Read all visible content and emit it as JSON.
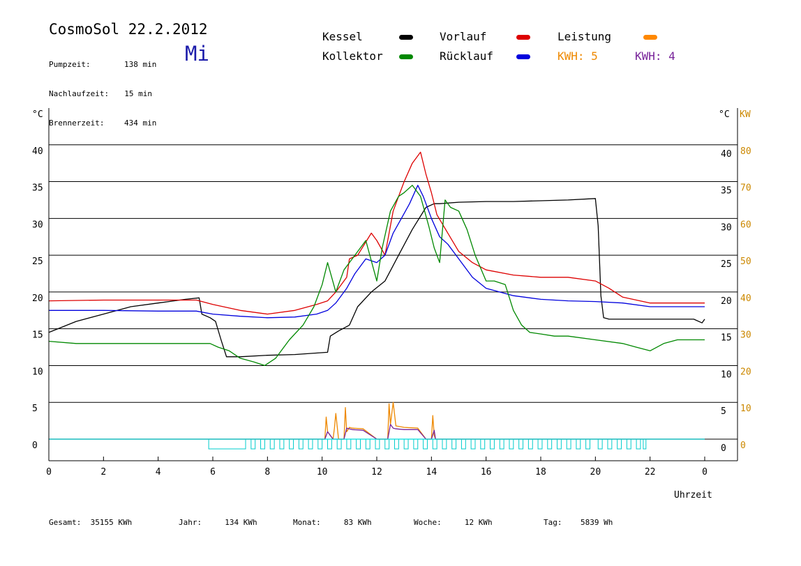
{
  "header": {
    "title": "CosmoSol 22.2.2012",
    "weekday": "Mi",
    "stats": [
      {
        "label": "Pumpzeit:",
        "value": "138 min"
      },
      {
        "label": "Nachlaufzeit:",
        "value": "15 min"
      },
      {
        "label": "Brennerzeit:",
        "value": "434 min"
      }
    ]
  },
  "legend": {
    "kessel": {
      "label": "Kessel",
      "color": "#000000"
    },
    "vorlauf": {
      "label": "Vorlauf",
      "color": "#dd0000"
    },
    "leistung": {
      "label": "Leistung",
      "color": "#ff8800"
    },
    "kollektor": {
      "label": "Kollektor",
      "color": "#008800"
    },
    "ruecklauf": {
      "label": "Rücklauf",
      "color": "#0000dd"
    },
    "kwh_orange": "KWH: 5",
    "kwh_purple": "KWH: 4",
    "kwh_orange_color": "#ee8800",
    "kwh_purple_color": "#772299"
  },
  "footer": {
    "gesamt": {
      "label": "Gesamt:",
      "value": "35155 KWh"
    },
    "jahr": {
      "label": "Jahr:",
      "value": "134 KWh"
    },
    "monat": {
      "label": "Monat:",
      "value": "83 KWh"
    },
    "woche": {
      "label": "Woche:",
      "value": "12 KWh"
    },
    "tag": {
      "label": "Tag:",
      "value": "5839 Wh"
    }
  },
  "chart_data": {
    "type": "line",
    "xlabel": "Uhrzeit",
    "ylabel_left": "°C",
    "ylabel_right": "°C",
    "ylabel_power": "KW",
    "xlim": [
      0,
      24
    ],
    "ylim": [
      0,
      45
    ],
    "x_ticks": [
      "0",
      "2",
      "4",
      "6",
      "8",
      "10",
      "12",
      "14",
      "16",
      "18",
      "20",
      "22",
      "0"
    ],
    "y_ticks_left": [
      "0",
      "5",
      "10",
      "15",
      "20",
      "25",
      "30",
      "35",
      "40"
    ],
    "y_ticks_right": [
      "0",
      "5",
      "10",
      "15",
      "20",
      "25",
      "30",
      "35",
      "40"
    ],
    "y_ticks_power": [
      "0",
      "10",
      "20",
      "30",
      "40",
      "50",
      "60",
      "70",
      "80"
    ],
    "grid": "horizontal",
    "series": [
      {
        "name": "Kessel",
        "color": "#000000",
        "x": [
          0,
          1,
          2,
          3,
          4,
          5,
          5.5,
          5.6,
          5.9,
          6.1,
          6.3,
          6.5,
          7,
          8,
          9,
          10.2,
          10.3,
          10.6,
          11,
          11.3,
          11.8,
          12.3,
          12.8,
          13.3,
          13.8,
          14.1,
          14.3,
          15,
          16,
          17,
          18,
          19,
          20,
          20.1,
          20.2,
          20.3,
          20.5,
          21,
          22,
          23,
          23.6,
          23.9,
          24
        ],
        "y": [
          14.5,
          16,
          17,
          18,
          18.5,
          19,
          19.2,
          17,
          16.5,
          16,
          13.5,
          11.2,
          11.2,
          11.4,
          11.5,
          11.8,
          14,
          14.7,
          15.5,
          18,
          20,
          21.5,
          25,
          28.5,
          31.5,
          32,
          32,
          32.2,
          32.3,
          32.3,
          32.4,
          32.5,
          32.7,
          29,
          19.5,
          16.5,
          16.3,
          16.3,
          16.3,
          16.3,
          16.3,
          15.8,
          16.3
        ]
      },
      {
        "name": "Vorlauf",
        "color": "#dd0000",
        "x": [
          0,
          2,
          4,
          5.4,
          6,
          7,
          8,
          9,
          9.8,
          10.2,
          10.5,
          10.9,
          11,
          11.3,
          11.8,
          12,
          12.3,
          12.6,
          12.8,
          13,
          13.3,
          13.6,
          13.8,
          14,
          14.2,
          14.6,
          15,
          15.5,
          16,
          17,
          18,
          19,
          20,
          20.5,
          21,
          22,
          23,
          24
        ],
        "y": [
          18.8,
          18.9,
          18.9,
          18.9,
          18.3,
          17.5,
          17,
          17.5,
          18.3,
          18.8,
          20,
          22,
          24.5,
          25,
          28,
          27,
          25,
          31,
          33,
          35,
          37.5,
          39,
          36,
          33.5,
          30.5,
          28,
          25.5,
          24,
          23,
          22.3,
          22,
          22,
          21.5,
          20.5,
          19.3,
          18.5,
          18.5,
          18.5
        ]
      },
      {
        "name": "Rücklauf",
        "color": "#0000dd",
        "x": [
          0,
          2,
          4,
          5.4,
          6,
          7,
          8,
          9,
          9.8,
          10.2,
          10.5,
          10.9,
          11.2,
          11.6,
          12,
          12.3,
          12.6,
          12.9,
          13.2,
          13.5,
          13.7,
          14,
          14.3,
          14.6,
          15,
          15.5,
          16,
          17,
          18,
          19,
          20,
          21,
          22,
          23,
          24
        ],
        "y": [
          17.5,
          17.5,
          17.4,
          17.4,
          17,
          16.7,
          16.5,
          16.6,
          17,
          17.5,
          18.5,
          20.5,
          22.5,
          24.5,
          24,
          25,
          28,
          30,
          32,
          34.5,
          33,
          30,
          27.5,
          26.5,
          24.5,
          22,
          20.5,
          19.5,
          19,
          18.8,
          18.7,
          18.5,
          18,
          18,
          18
        ]
      },
      {
        "name": "Kollektor",
        "color": "#008800",
        "x": [
          0,
          1,
          2,
          3,
          4,
          5,
          5.9,
          6.2,
          6.6,
          7,
          7.5,
          7.9,
          8.3,
          8.8,
          9.3,
          9.7,
          10,
          10.2,
          10.5,
          10.8,
          11.2,
          11.6,
          12,
          12.2,
          12.5,
          12.8,
          13,
          13.3,
          13.6,
          13.9,
          14.1,
          14.3,
          14.5,
          14.7,
          15,
          15.3,
          15.6,
          16,
          16.3,
          16.7,
          17,
          17.3,
          17.6,
          18,
          18.5,
          19,
          20,
          21,
          21.5,
          22,
          22.5,
          23,
          23.5,
          24
        ],
        "y": [
          13.3,
          13,
          13,
          13,
          13,
          13,
          13,
          12.5,
          12,
          11,
          10.5,
          10,
          11,
          13.5,
          15.5,
          18,
          21,
          24,
          20,
          23,
          25,
          27,
          21.5,
          26,
          31,
          33,
          33.5,
          34.5,
          33,
          29,
          26,
          24,
          32.5,
          31.5,
          31,
          28.5,
          25,
          21.5,
          21.5,
          21,
          17.5,
          15.5,
          14.5,
          14.3,
          14,
          14,
          13.5,
          13,
          12.5,
          12,
          13,
          13.5,
          13.5,
          13.5
        ]
      },
      {
        "name": "Leistung",
        "color": "#ee8800",
        "x": [
          0,
          10.1,
          10.15,
          10.2,
          10.4,
          10.45,
          10.5,
          10.6,
          10.8,
          10.85,
          10.9,
          11,
          11.1,
          11.5,
          12,
          12.4,
          12.45,
          12.5,
          12.6,
          12.7,
          13,
          13.5,
          13.8,
          13.9,
          14,
          14.05,
          14.1,
          14.15,
          24
        ],
        "y": [
          0,
          0,
          3,
          1,
          0,
          1.5,
          3.5,
          0,
          0,
          4.3,
          1,
          1.6,
          1.5,
          1.4,
          0,
          0,
          4.8,
          2,
          5,
          1.8,
          1.6,
          1.5,
          0,
          0,
          0,
          3.2,
          0.5,
          0,
          0
        ]
      },
      {
        "name": "KWH 4",
        "color": "#772299",
        "x": [
          0,
          10.1,
          10.2,
          10.4,
          10.6,
          10.8,
          10.9,
          11,
          11.1,
          11.5,
          12,
          12.4,
          12.5,
          12.6,
          12.7,
          13,
          13.5,
          13.8,
          14,
          14.1,
          14.15,
          24
        ],
        "y": [
          0,
          0,
          1,
          0,
          0,
          0,
          1.5,
          1.4,
          1.3,
          1.2,
          0,
          0,
          2,
          1.5,
          1.4,
          1.3,
          1.3,
          0,
          0,
          1.2,
          0,
          0
        ]
      },
      {
        "name": "Pumpe",
        "color": "#00dddd",
        "x": [
          0,
          24
        ],
        "y": [
          0,
          0
        ]
      }
    ],
    "pump_on": [
      [
        5.85,
        7.2
      ],
      [
        7.4,
        7.55
      ],
      [
        7.75,
        7.9
      ],
      [
        8.1,
        8.25
      ],
      [
        8.45,
        8.6
      ],
      [
        8.8,
        8.95
      ],
      [
        9.15,
        9.3
      ],
      [
        9.5,
        9.65
      ],
      [
        9.85,
        10
      ],
      [
        10.2,
        10.35
      ],
      [
        10.55,
        10.7
      ],
      [
        10.9,
        11.05
      ],
      [
        11.25,
        11.4
      ],
      [
        11.6,
        11.75
      ],
      [
        11.95,
        12.1
      ],
      [
        12.3,
        12.45
      ],
      [
        12.65,
        12.8
      ],
      [
        13,
        13.15
      ],
      [
        13.35,
        13.5
      ],
      [
        13.7,
        13.85
      ],
      [
        14.05,
        14.2
      ],
      [
        14.4,
        14.55
      ],
      [
        14.75,
        14.9
      ],
      [
        15.1,
        15.25
      ],
      [
        15.45,
        15.6
      ],
      [
        15.8,
        15.95
      ],
      [
        16.15,
        16.3
      ],
      [
        16.5,
        16.65
      ],
      [
        16.85,
        17
      ],
      [
        17.2,
        17.35
      ],
      [
        17.55,
        17.7
      ],
      [
        17.9,
        18.05
      ],
      [
        18.25,
        18.4
      ],
      [
        18.6,
        18.75
      ],
      [
        18.95,
        19.1
      ],
      [
        19.3,
        19.45
      ],
      [
        19.65,
        19.8
      ],
      [
        20.1,
        20.25
      ],
      [
        20.45,
        20.6
      ],
      [
        20.8,
        20.95
      ],
      [
        21.15,
        21.3
      ],
      [
        21.5,
        21.65
      ],
      [
        21.75,
        21.85
      ]
    ]
  }
}
